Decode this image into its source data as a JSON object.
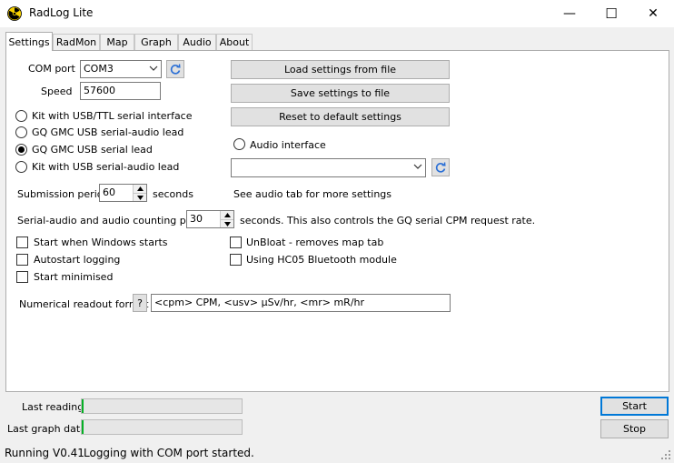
{
  "window": {
    "title": "RadLog Lite",
    "minimize_glyph": "—",
    "maximize_glyph": "☐",
    "close_glyph": "✕"
  },
  "tabs": [
    {
      "label": "Settings",
      "active": true
    },
    {
      "label": "RadMon"
    },
    {
      "label": "Map"
    },
    {
      "label": "Graph"
    },
    {
      "label": "Audio"
    },
    {
      "label": "About"
    }
  ],
  "settings": {
    "com_port_label": "COM port",
    "com_port_value": "COM3",
    "speed_label": "Speed",
    "speed_value": "57600",
    "load_button": "Load settings from file",
    "save_button": "Save settings to file",
    "reset_button": "Reset to default settings",
    "radios": [
      {
        "label": "Kit with USB/TTL serial interface",
        "selected": false
      },
      {
        "label": "GQ GMC USB serial-audio lead",
        "selected": false
      },
      {
        "label": "GQ GMC USB serial lead",
        "selected": true
      },
      {
        "label": "Kit with USB serial-audio lead",
        "selected": false
      }
    ],
    "audio_interface_label": "Audio interface",
    "audio_interface_value": "",
    "submission_label": "Submission period",
    "submission_value": "60",
    "submission_unit": "seconds",
    "audio_tab_note": "See audio tab for more settings",
    "serial_audio_label": "Serial-audio and audio counting period",
    "serial_audio_value": "30",
    "serial_audio_note": "seconds. This also controls the GQ serial CPM request rate.",
    "checks_left": [
      {
        "label": "Start when Windows starts",
        "checked": false
      },
      {
        "label": "Autostart logging",
        "checked": false
      },
      {
        "label": "Start minimised",
        "checked": false
      }
    ],
    "checks_right": [
      {
        "label": "UnBloat - removes map tab",
        "checked": false
      },
      {
        "label": "Using HC05 Bluetooth module",
        "checked": false
      }
    ],
    "readout_label": "Numerical readout format",
    "readout_help": "?",
    "readout_value": "<cpm> CPM, <usv> µSv/hr, <mr> mR/hr"
  },
  "bottom": {
    "last_reading_label": "Last reading",
    "last_reading_progress": 0.01,
    "last_graph_label": "Last graph data",
    "last_graph_progress": 0.01,
    "start_button": "Start",
    "stop_button": "Stop"
  },
  "status": {
    "state": "Running",
    "version": "V0.41",
    "message": "Logging with COM port started."
  },
  "colors": {
    "progress_fill": "#06b025",
    "accent": "#0078d7"
  }
}
